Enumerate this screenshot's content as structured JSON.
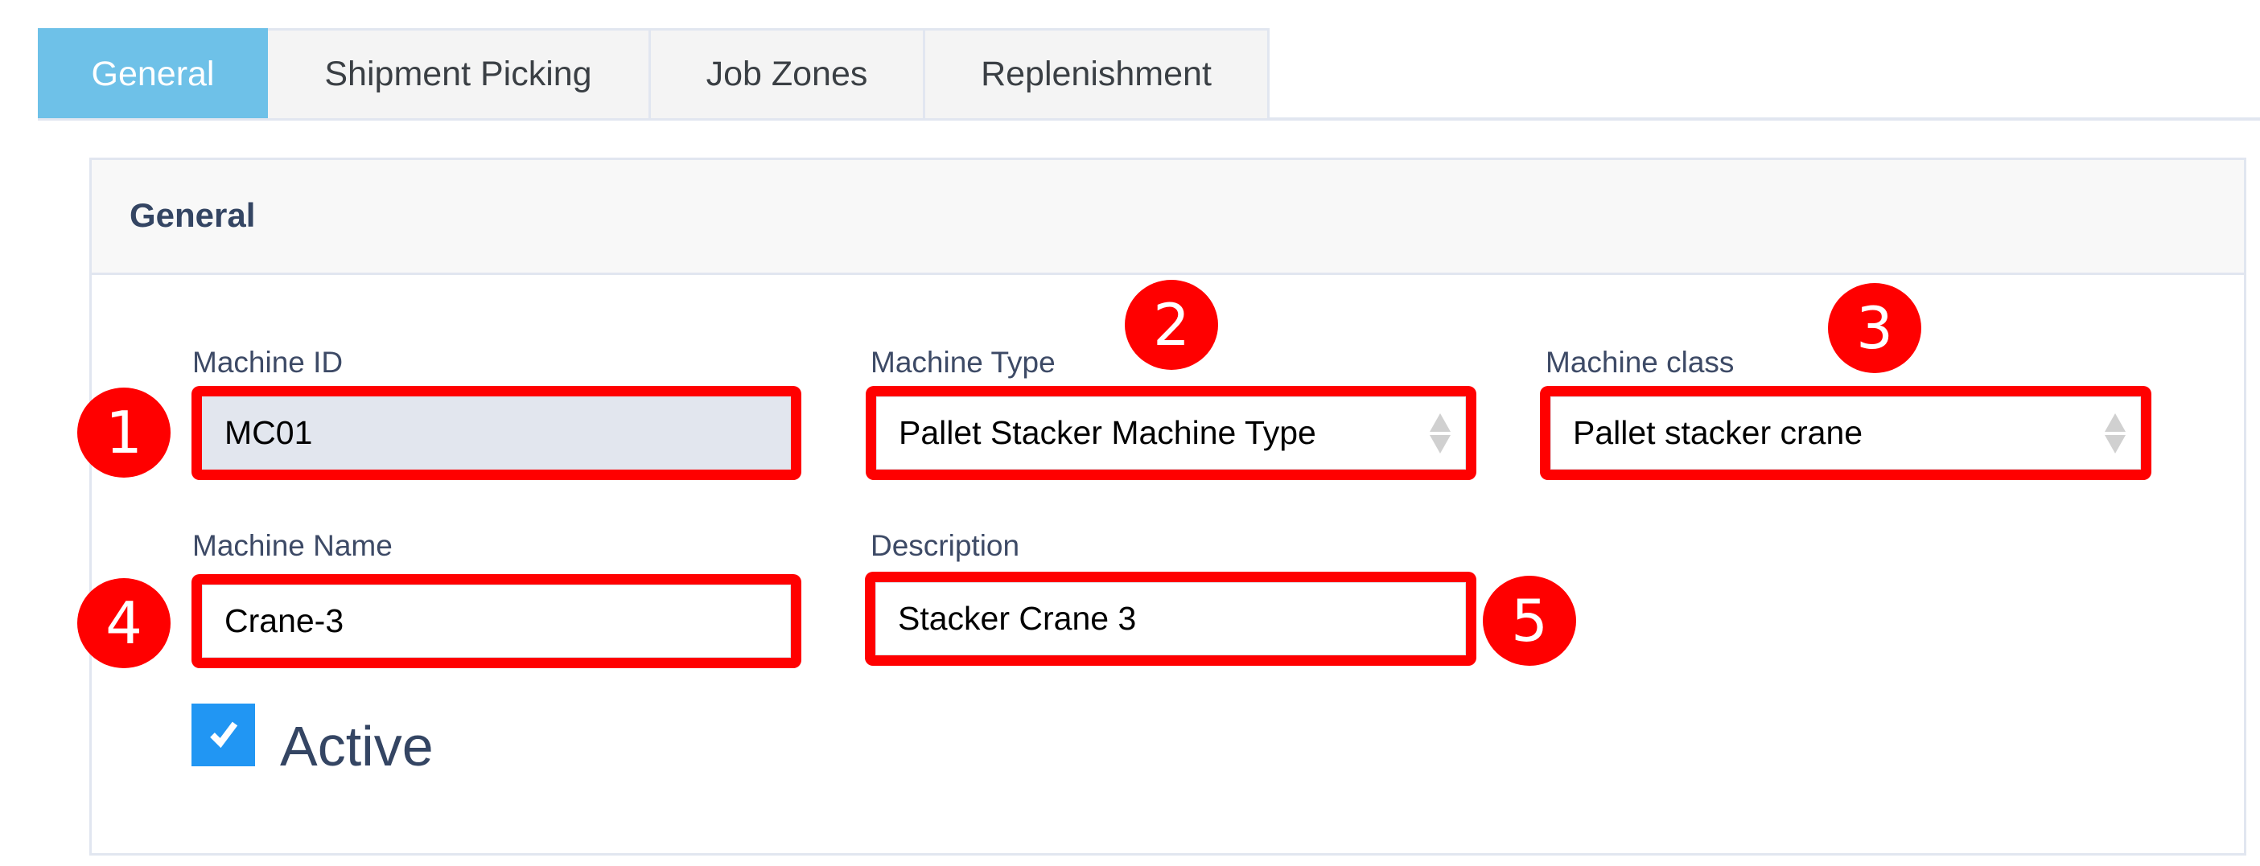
{
  "tabs": [
    {
      "label": "General",
      "active": true
    },
    {
      "label": "Shipment Picking",
      "active": false
    },
    {
      "label": "Job Zones",
      "active": false
    },
    {
      "label": "Replenishment",
      "active": false
    }
  ],
  "panel": {
    "title": "General",
    "fields": {
      "machine_id": {
        "label": "Machine ID",
        "value": "MC01",
        "readonly": true
      },
      "machine_type": {
        "label": "Machine Type",
        "value": "Pallet Stacker Machine Type",
        "type": "select"
      },
      "machine_class": {
        "label": "Machine class",
        "value": "Pallet stacker crane",
        "type": "select"
      },
      "machine_name": {
        "label": "Machine Name",
        "value": "Crane-3"
      },
      "description": {
        "label": "Description",
        "value": "Stacker Crane 3"
      }
    },
    "active_checkbox": {
      "label": "Active",
      "checked": true,
      "check_glyph": "✔"
    }
  },
  "annotations": {
    "badges": [
      "1",
      "2",
      "3",
      "4",
      "5"
    ],
    "highlight_color": "#ff0000"
  },
  "colors": {
    "active_tab": "#6ec1e8",
    "checkbox": "#2196f3"
  }
}
